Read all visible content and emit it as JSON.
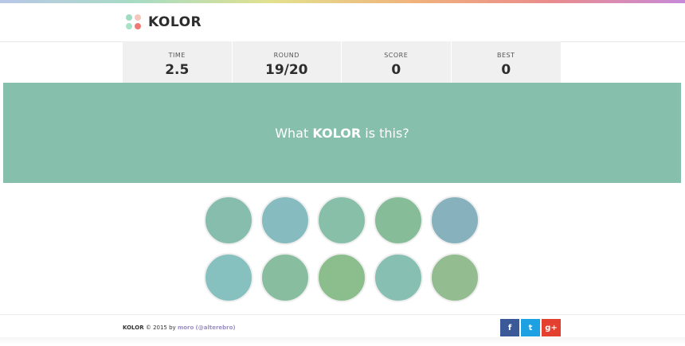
{
  "header": {
    "logo_text": "KOLOR",
    "logo_dots": [
      "#9fdcc0",
      "#f4c7bd",
      "#a8e3c8",
      "#f07a73"
    ]
  },
  "stats": [
    {
      "label": "TIME",
      "value": "2.5"
    },
    {
      "label": "ROUND",
      "value": "19/20"
    },
    {
      "label": "SCORE",
      "value": "0"
    },
    {
      "label": "BEST",
      "value": "0"
    }
  ],
  "prompt": {
    "prefix": "What ",
    "brand": "KOLOR",
    "suffix": " is this?",
    "color": "#87bfad"
  },
  "swatches": [
    "#87bdad",
    "#86bcbf",
    "#88bfa9",
    "#86bd98",
    "#87b2bd",
    "#86c0bf",
    "#88be9f",
    "#8bbe8c",
    "#87bfb3",
    "#93bc90"
  ],
  "footer": {
    "brand": "KOLOR",
    "middle": " © 2015 by ",
    "author": "moro",
    "handle": "(@alterebro)"
  },
  "social": [
    {
      "icon": "facebook-icon",
      "glyph": "f",
      "color": "#3b5998"
    },
    {
      "icon": "twitter-icon",
      "glyph": "t",
      "color": "#1da1e2"
    },
    {
      "icon": "google-plus-icon",
      "glyph": "g+",
      "color": "#e4402f"
    }
  ]
}
